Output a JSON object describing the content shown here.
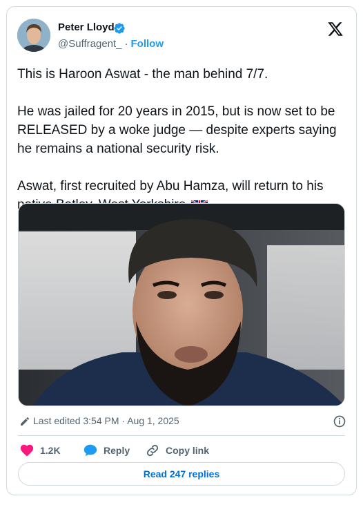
{
  "author": {
    "name": "Peter Lloyd",
    "handle": "@Suffragent_",
    "separator": "·",
    "follow_label": "Follow",
    "verified": true,
    "avatar": "profile-photo"
  },
  "brand": {
    "logo": "x-logo-icon"
  },
  "tweet": {
    "paragraphs": [
      "This is Haroon Aswat - the man behind 7/7.",
      "He was jailed for 20 years in 2015, but is now set to be RELEASED by a woke judge — despite experts saying he remains a national security risk.",
      "Aswat, first recruited by Abu Hamza, will return to his native Batley, West Yorkshire."
    ],
    "trailing_emoji": "uk-flag-icon",
    "media": "photo-of-bearded-man-in-dark-cap"
  },
  "meta": {
    "edited": "Last edited 3:54 PM · Aug 1, 2025",
    "edit_icon": "pencil-icon",
    "info_icon": "info-icon"
  },
  "actions": {
    "like_count": "1.2K",
    "reply_label": "Reply",
    "copy_label": "Copy link",
    "read_replies_label": "Read 247 replies"
  },
  "colors": {
    "accent": "#1d9bf0",
    "like": "#f91880",
    "text": "#0f1419",
    "secondary": "#536471",
    "border": "#cfd9de"
  }
}
